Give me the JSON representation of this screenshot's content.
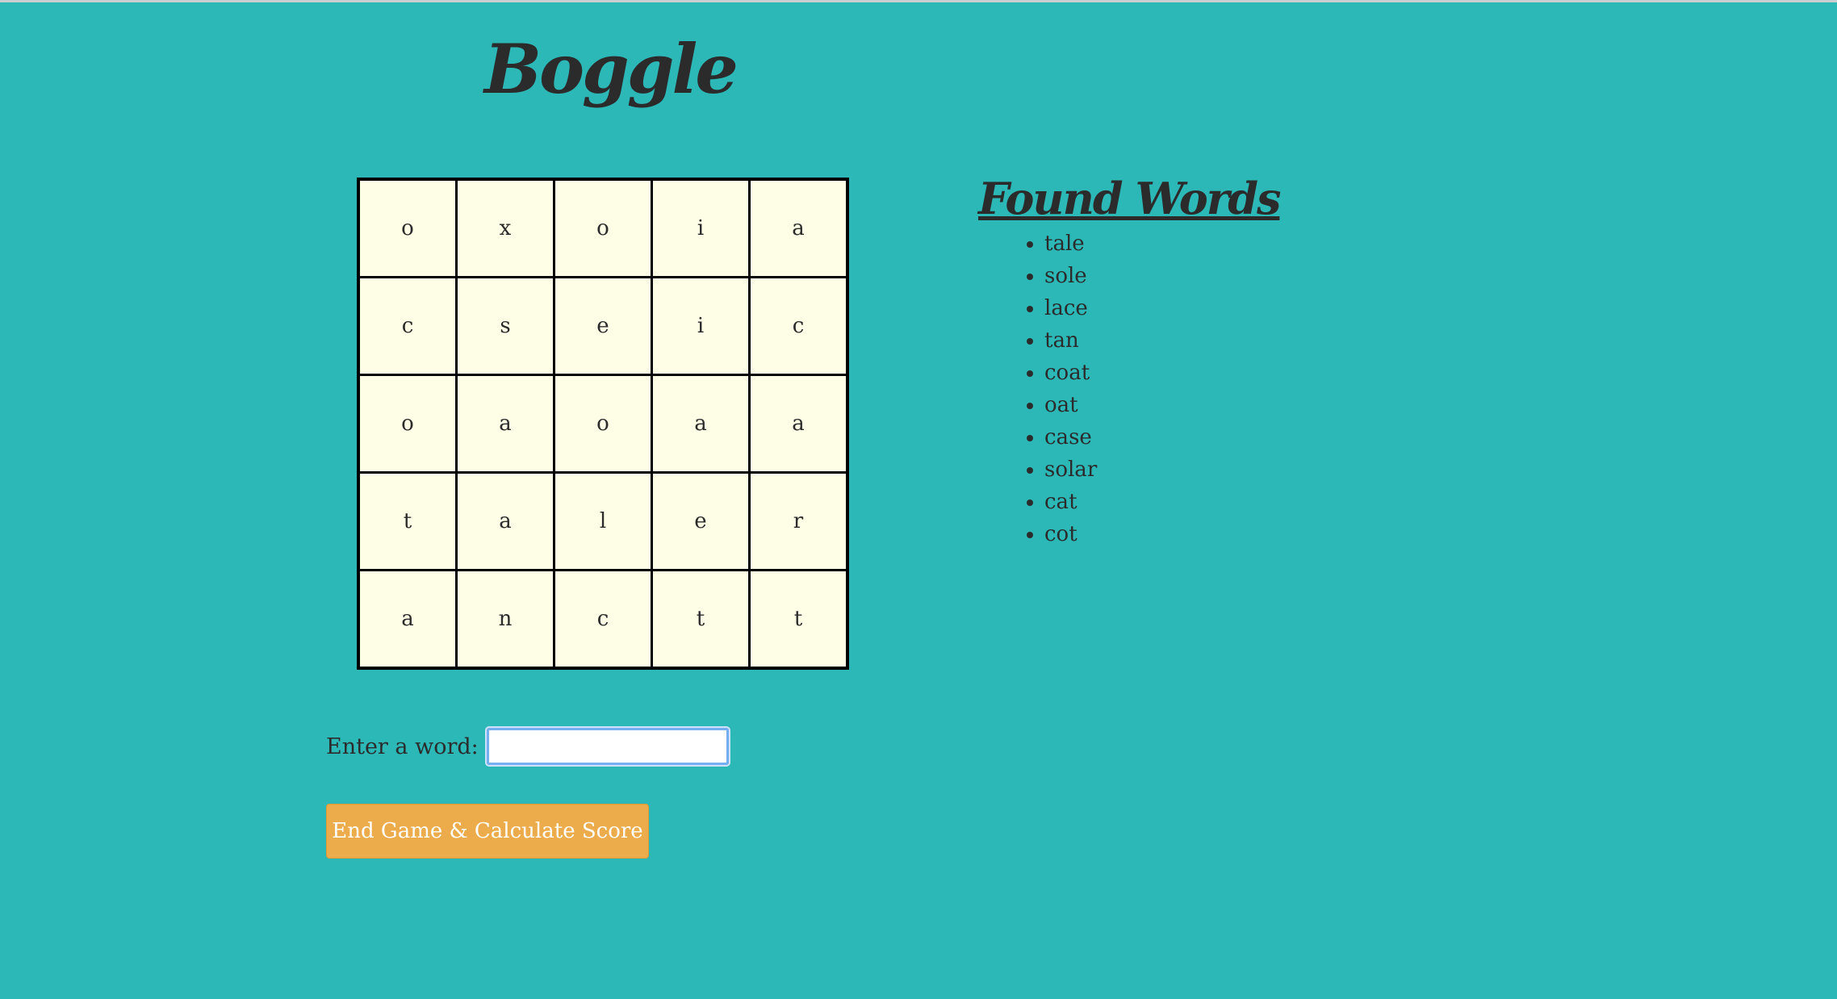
{
  "app": {
    "title": "Boggle"
  },
  "board": {
    "rows": [
      [
        "o",
        "x",
        "o",
        "i",
        "a"
      ],
      [
        "c",
        "s",
        "e",
        "i",
        "c"
      ],
      [
        "o",
        "a",
        "o",
        "a",
        "a"
      ],
      [
        "t",
        "a",
        "l",
        "e",
        "r"
      ],
      [
        "a",
        "n",
        "c",
        "t",
        "t"
      ]
    ]
  },
  "found_words": {
    "title": "Found Words",
    "words": [
      "tale",
      "sole",
      "lace",
      "tan",
      "coat",
      "oat",
      "case",
      "solar",
      "cat",
      "cot"
    ]
  },
  "entry": {
    "label": "Enter a word:",
    "value": "",
    "placeholder": ""
  },
  "end_button": {
    "label": "End Game & Calculate Score"
  },
  "colors": {
    "background": "#2db8b8",
    "cell": "#fefde5",
    "button": "#edac4c",
    "text": "#2b2b2b"
  }
}
